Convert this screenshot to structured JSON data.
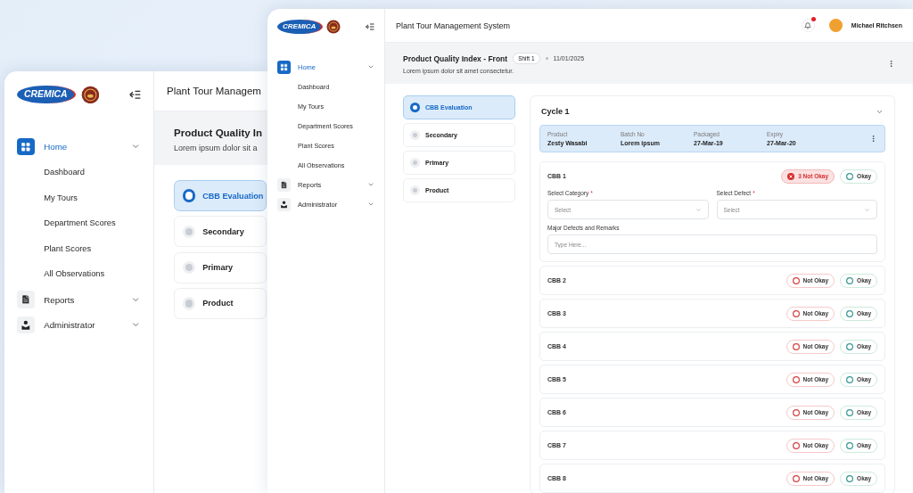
{
  "back_window": {
    "brand": {
      "wordmark": "CREMICA"
    },
    "nav": [
      {
        "label": "Home",
        "kind": "grid",
        "selected": true,
        "children": [
          {
            "label": "Dashboard",
            "selected": false
          },
          {
            "label": "My Tours",
            "selected": false
          },
          {
            "label": "Department Scores",
            "selected": false
          },
          {
            "label": "Plant Scores",
            "selected": false
          },
          {
            "label": "All Observations",
            "selected": false
          }
        ]
      },
      {
        "label": "Reports",
        "kind": "document",
        "selected": false
      },
      {
        "label": "Administrator",
        "kind": "person",
        "selected": false
      }
    ],
    "header_title": "Plant Tour Managem",
    "page": {
      "title": "Product Quality In",
      "subtitle": "Lorem ipsum dolor sit a"
    },
    "steps": [
      {
        "label": "CBB Evaluation",
        "selected": true
      },
      {
        "label": "Secondary",
        "selected": false
      },
      {
        "label": "Primary",
        "selected": false
      },
      {
        "label": "Product",
        "selected": false
      }
    ]
  },
  "front_window": {
    "brand": {
      "wordmark": "CREMICA"
    },
    "nav": [
      {
        "label": "Home",
        "kind": "grid",
        "selected": true,
        "children": [
          {
            "label": "Dashboard",
            "selected": false
          },
          {
            "label": "My Tours",
            "selected": false
          },
          {
            "label": "Department Scores",
            "selected": false
          },
          {
            "label": "Plant Scores",
            "selected": false
          },
          {
            "label": "All Observations",
            "selected": false
          }
        ]
      },
      {
        "label": "Reports",
        "kind": "document",
        "selected": false
      },
      {
        "label": "Administrator",
        "kind": "person",
        "selected": false
      }
    ],
    "header_title": "Plant Tour Management System",
    "notification": true,
    "user": {
      "name": "Michael Ritchsen"
    },
    "page": {
      "title": "Product Quality Index - Front",
      "shift": "Shift 1",
      "date": "11/01/2025",
      "subtitle": "Lorem ipsum dolor sit amet consectetur."
    },
    "steps": [
      {
        "label": "CBB Evaluation",
        "selected": true
      },
      {
        "label": "Secondary",
        "selected": false
      },
      {
        "label": "Primary",
        "selected": false
      },
      {
        "label": "Product",
        "selected": false
      }
    ],
    "cycle": {
      "title": "Cycle 1",
      "info": [
        {
          "label": "Product",
          "value": "Zesty Wasabi"
        },
        {
          "label": "Batch No",
          "value": "Lorem ipsum"
        },
        {
          "label": "Packaged",
          "value": "27-Mar-19"
        },
        {
          "label": "Expiry",
          "value": "27-Mar-20"
        }
      ],
      "checks": [
        {
          "name": "CBB 1",
          "not_okay": {
            "label": "3 Not Okay",
            "selected": true
          },
          "okay": {
            "label": "Okay",
            "selected": false
          },
          "form": {
            "fields": [
              {
                "label": "Select Category",
                "required_mark": "*",
                "placeholder": "Select"
              },
              {
                "label": "Select Defect",
                "required_mark": "*",
                "placeholder": "Select"
              }
            ],
            "remarks": {
              "label": "Major Defects and Remarks",
              "placeholder": "Type Here..."
            }
          }
        },
        {
          "name": "CBB 2",
          "not_okay": {
            "label": "Not Okay",
            "selected": false
          },
          "okay": {
            "label": "Okay",
            "selected": false
          }
        },
        {
          "name": "CBB 3",
          "not_okay": {
            "label": "Not Okay",
            "selected": false
          },
          "okay": {
            "label": "Okay",
            "selected": false
          }
        },
        {
          "name": "CBB 4",
          "not_okay": {
            "label": "Not Okay",
            "selected": false
          },
          "okay": {
            "label": "Okay",
            "selected": false
          }
        },
        {
          "name": "CBB 5",
          "not_okay": {
            "label": "Not Okay",
            "selected": false
          },
          "okay": {
            "label": "Okay",
            "selected": false
          }
        },
        {
          "name": "CBB 6",
          "not_okay": {
            "label": "Not Okay",
            "selected": false
          },
          "okay": {
            "label": "Okay",
            "selected": false
          }
        },
        {
          "name": "CBB 7",
          "not_okay": {
            "label": "Not Okay",
            "selected": false
          },
          "okay": {
            "label": "Okay",
            "selected": false
          }
        },
        {
          "name": "CBB 8",
          "not_okay": {
            "label": "Not Okay",
            "selected": false
          },
          "okay": {
            "label": "Okay",
            "selected": false
          }
        }
      ]
    }
  }
}
